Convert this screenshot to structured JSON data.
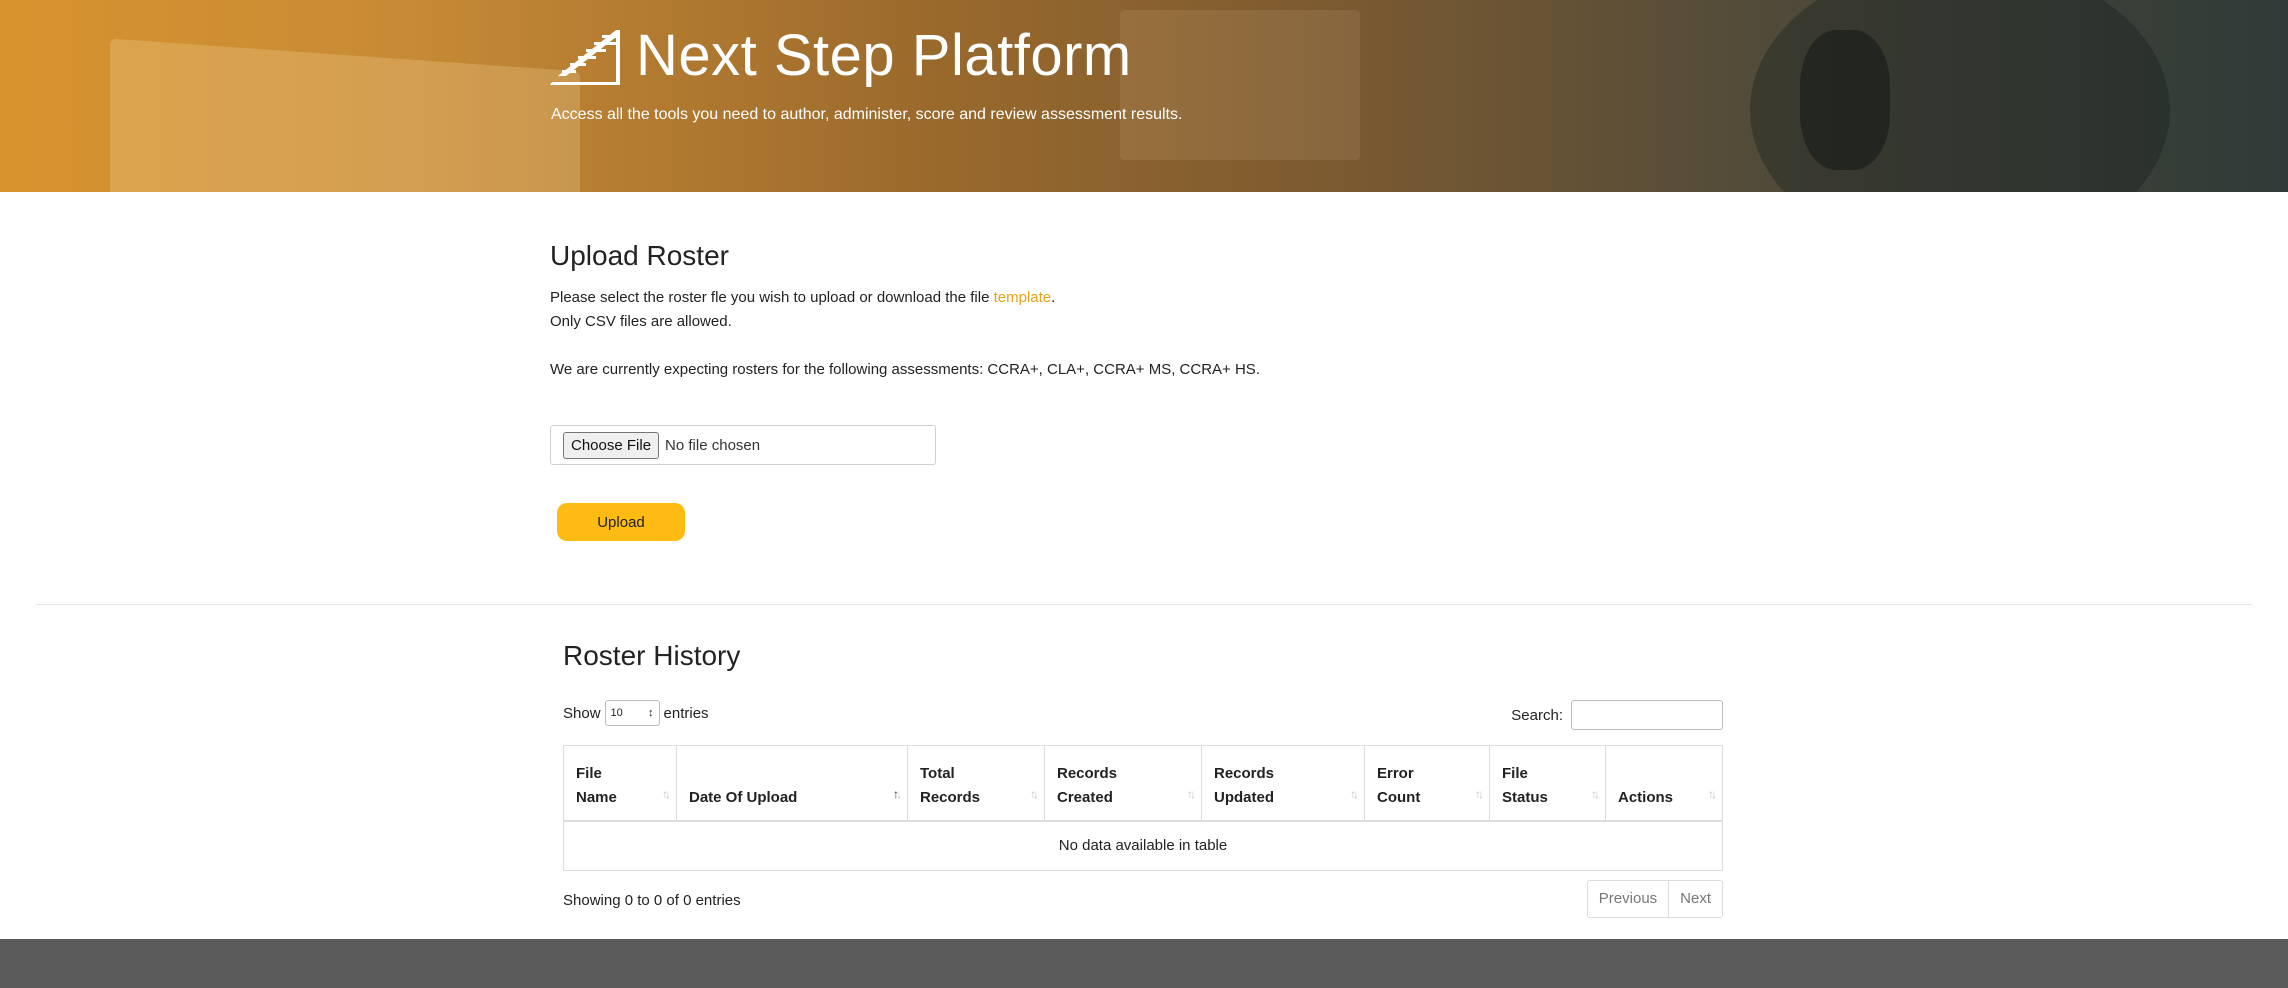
{
  "hero": {
    "title": "Next Step Platform",
    "subtitle": "Access all the tools you need to author, administer, score and review assessment results."
  },
  "upload": {
    "heading": "Upload Roster",
    "instruction_prefix": "Please select the roster fle you wish to upload or download the file ",
    "template_link": "template",
    "instruction_suffix": ".",
    "csv_note": "Only CSV files are allowed.",
    "expecting_note": "We are currently expecting rosters for the following assessments: CCRA+, CLA+, CCRA+ MS, CCRA+ HS.",
    "choose_file_label": "Choose File",
    "file_status": "No file chosen",
    "upload_button": "Upload"
  },
  "history": {
    "heading": "Roster History",
    "show_label": "Show",
    "entries_value": "10",
    "entries_label": "entries",
    "search_label": "Search:",
    "search_value": "",
    "columns": [
      {
        "line1": "File",
        "line2": "Name"
      },
      {
        "line1": "",
        "line2": "Date Of Upload"
      },
      {
        "line1": "Total",
        "line2": "Records"
      },
      {
        "line1": "Records",
        "line2": "Created"
      },
      {
        "line1": "Records",
        "line2": "Updated"
      },
      {
        "line1": "Error",
        "line2": "Count"
      },
      {
        "line1": "File",
        "line2": "Status"
      },
      {
        "line1": "",
        "line2": "Actions"
      }
    ],
    "empty_message": "No data available in table",
    "info": "Showing 0 to 0 of 0 entries",
    "previous": "Previous",
    "next": "Next"
  },
  "colors": {
    "accent": "#fdbb13",
    "link": "#e9a21b",
    "footer": "#5a5a5a"
  }
}
